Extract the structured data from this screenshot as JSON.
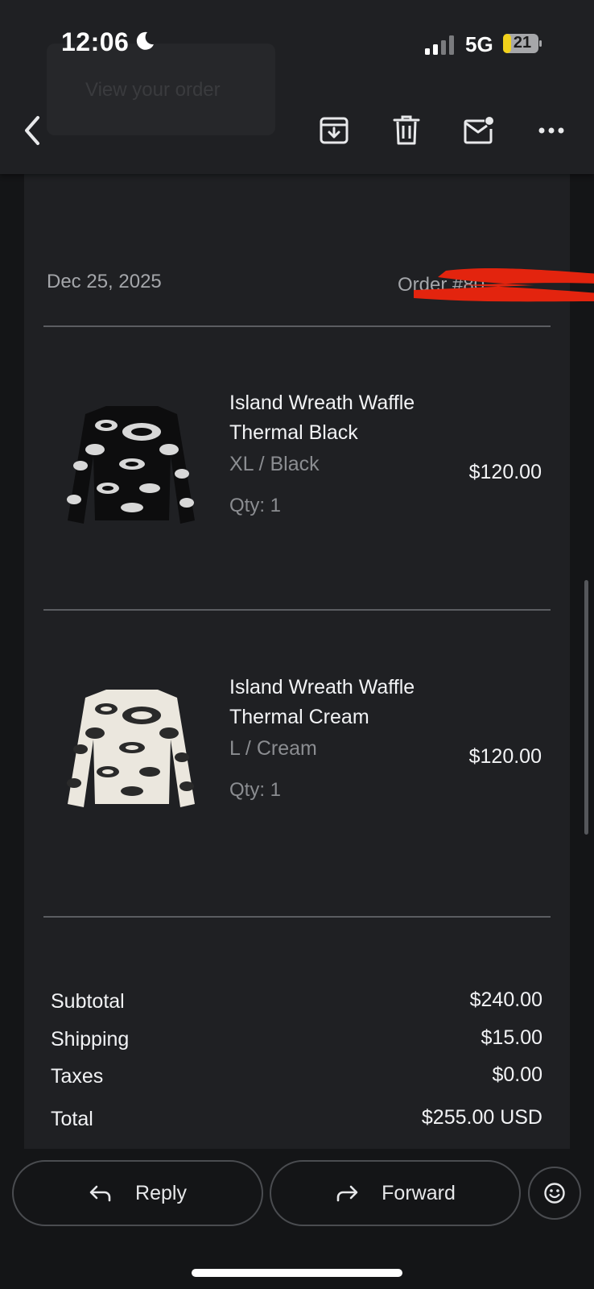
{
  "status_bar": {
    "time": "12:06",
    "network": "5G",
    "battery": "21"
  },
  "header": {
    "ghost_button_label": "View your order"
  },
  "toolbar": {
    "back_icon": "chevron-left-icon",
    "archive_icon": "archive-icon",
    "delete_icon": "trash-icon",
    "mark_unread_icon": "mail-unread-icon",
    "more_icon": "more-horizontal-icon"
  },
  "email": {
    "date": "Dec 25, 2025",
    "order_label": "Order #80",
    "items": [
      {
        "name_line1": "Island Wreath Waffle",
        "name_line2": "Thermal Black",
        "variant": "XL / Black",
        "qty": "Qty: 1",
        "price": "$120.00"
      },
      {
        "name_line1": "Island Wreath Waffle",
        "name_line2": "Thermal Cream",
        "variant": "L / Cream",
        "qty": "Qty: 1",
        "price": "$120.00"
      }
    ],
    "summary": {
      "subtotal_label": "Subtotal",
      "subtotal": "$240.00",
      "shipping_label": "Shipping",
      "shipping": "$15.00",
      "taxes_label": "Taxes",
      "taxes": "$0.00",
      "total_label": "Total",
      "total": "$255.00 USD"
    }
  },
  "actions": {
    "reply": "Reply",
    "forward": "Forward"
  },
  "colors": {
    "background": "#141517",
    "surface": "#1f2023",
    "redaction": "#e3240e"
  }
}
